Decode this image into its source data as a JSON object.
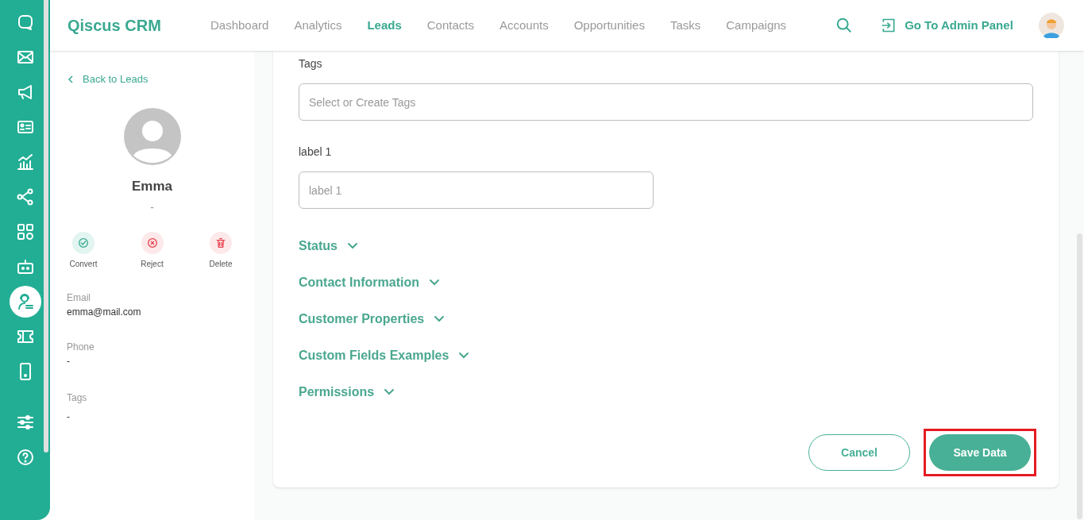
{
  "rail": [
    {
      "kind": "chat",
      "selected": false
    },
    {
      "kind": "mail",
      "selected": false
    },
    {
      "kind": "megaphone",
      "selected": false
    },
    {
      "kind": "card",
      "selected": false
    },
    {
      "kind": "chart",
      "selected": false
    },
    {
      "kind": "share",
      "selected": false
    },
    {
      "kind": "grid",
      "selected": false
    },
    {
      "kind": "robot",
      "selected": false
    },
    {
      "kind": "agent",
      "selected": true
    },
    {
      "kind": "ticket",
      "selected": false
    },
    {
      "kind": "phone",
      "selected": false
    },
    {
      "kind": "sliders",
      "selected": false
    },
    {
      "kind": "help",
      "selected": false
    }
  ],
  "header": {
    "brand": "Qiscus CRM",
    "nav": [
      {
        "label": "Dashboard",
        "selected": false
      },
      {
        "label": "Analytics",
        "selected": false
      },
      {
        "label": "Leads",
        "selected": true
      },
      {
        "label": "Contacts",
        "selected": false
      },
      {
        "label": "Accounts",
        "selected": false
      },
      {
        "label": "Opportunities",
        "selected": false
      },
      {
        "label": "Tasks",
        "selected": false
      },
      {
        "label": "Campaigns",
        "selected": false
      }
    ],
    "admin_link": "Go To Admin Panel"
  },
  "profile": {
    "back": "Back to Leads",
    "name": "Emma",
    "subtitle": "-",
    "actions": [
      {
        "kind": "convert",
        "label": "Convert"
      },
      {
        "kind": "reject",
        "label": "Reject"
      },
      {
        "kind": "delete",
        "label": "Delete"
      }
    ],
    "fields": [
      {
        "label": "Email",
        "value": "emma@mail.com"
      },
      {
        "label": "Phone",
        "value": "-"
      },
      {
        "label": "Tags",
        "value": "-"
      }
    ]
  },
  "form": {
    "fields": [
      {
        "label": "Tags",
        "placeholder": "Select or Create Tags",
        "wide": true
      },
      {
        "label": "label 1",
        "placeholder": "label 1",
        "wide": false
      }
    ],
    "sections": [
      {
        "title": "Status",
        "expanded": false
      },
      {
        "title": "Contact Information",
        "expanded": false
      },
      {
        "title": "Customer Properties",
        "expanded": false
      },
      {
        "title": "Custom Fields Examples",
        "expanded": false
      },
      {
        "title": "Permissions",
        "expanded": false
      }
    ],
    "buttons": [
      {
        "kind": "secondary",
        "label": "Cancel",
        "highlighted": false
      },
      {
        "kind": "primary",
        "label": "Save Data",
        "highlighted": true
      }
    ]
  }
}
